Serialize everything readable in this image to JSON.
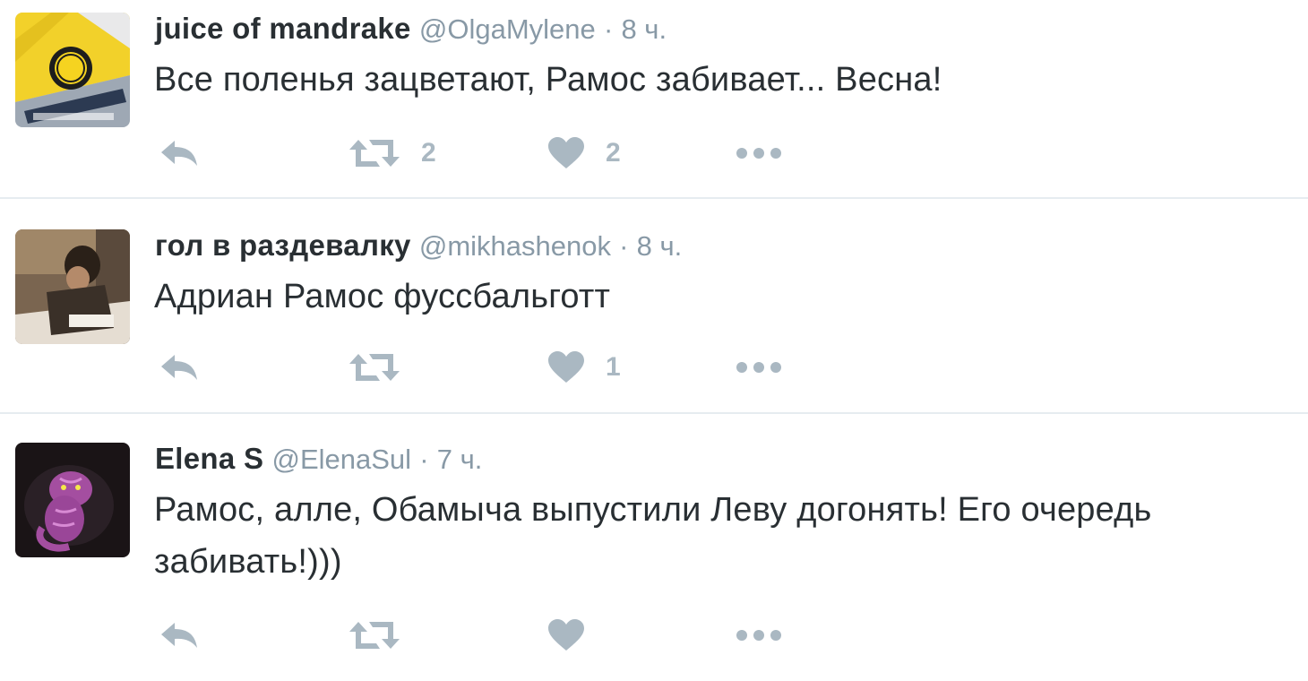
{
  "tweets": [
    {
      "fullname": "juice of mandrake",
      "username": "@OlgaMylene",
      "separator": "·",
      "time": "8 ч.",
      "text": "Все поленья зацветают, Рамос забивает... Весна!",
      "retweets": "2",
      "likes": "2"
    },
    {
      "fullname": "гол в раздевалку",
      "username": "@mikhashenok",
      "separator": "·",
      "time": "8 ч.",
      "text": "Адриан Рамос фуссбальготт",
      "retweets": "",
      "likes": "1"
    },
    {
      "fullname": "Elena S",
      "username": "@ElenaSul",
      "separator": "·",
      "time": "7 ч.",
      "text": "Рамос, алле, Обамыча выпустили Леву догонять! Его очередь забивать!)))",
      "retweets": "",
      "likes": ""
    }
  ],
  "colors": {
    "name": "#292f33",
    "meta": "#8899a6",
    "icon": "#aab8c2",
    "divider": "#e6ecf0"
  },
  "icons": [
    "reply-icon",
    "retweet-icon",
    "heart-icon",
    "more-icon"
  ]
}
